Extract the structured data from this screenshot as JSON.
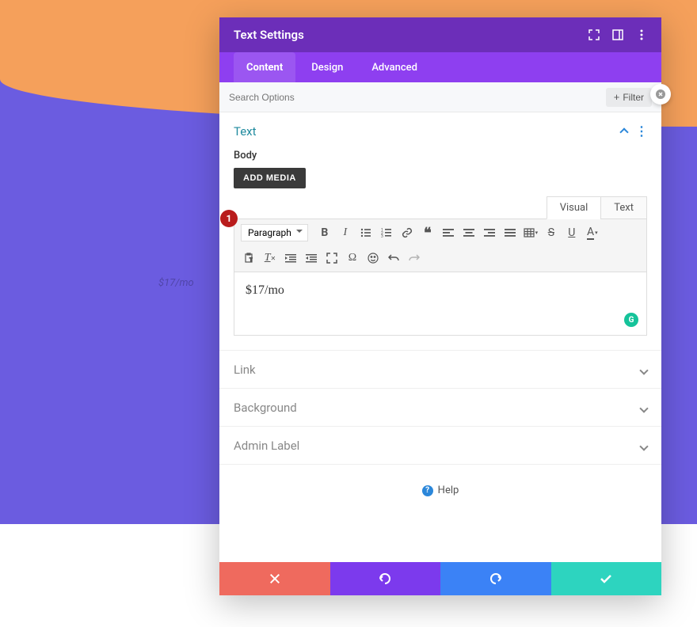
{
  "modal": {
    "title": "Text Settings",
    "tabs": [
      "Content",
      "Design",
      "Advanced"
    ],
    "active_tab": 0
  },
  "search": {
    "placeholder": "Search Options",
    "filter_label": "Filter"
  },
  "sections": {
    "text": {
      "title": "Text",
      "body_label": "Body"
    },
    "link": {
      "title": "Link"
    },
    "background": {
      "title": "Background"
    },
    "admin_label": {
      "title": "Admin Label"
    }
  },
  "editor": {
    "add_media_label": "ADD MEDIA",
    "tab_visual": "Visual",
    "tab_text": "Text",
    "format": "Paragraph",
    "content": "$17/mo"
  },
  "help": {
    "label": "Help"
  },
  "preview_text": "$17/mo",
  "step_badge": "1"
}
